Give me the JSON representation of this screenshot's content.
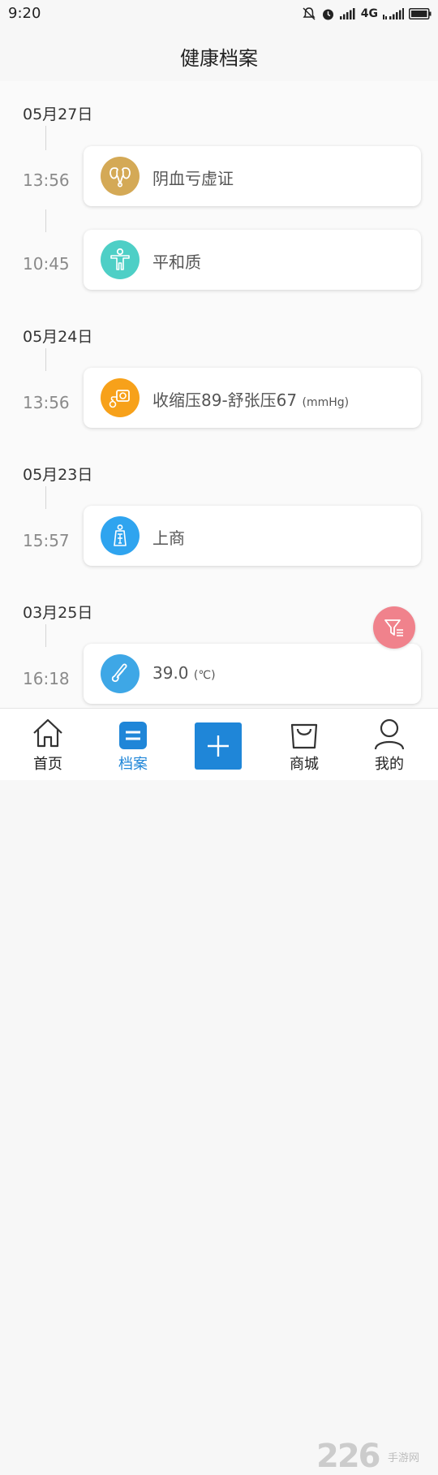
{
  "status_bar": {
    "time": "9:20",
    "network": "4G"
  },
  "header": {
    "title": "健康档案"
  },
  "timeline": [
    {
      "date": "05月27日",
      "entries": [
        {
          "time": "13:56",
          "text": "阴血亏虚证",
          "unit": "",
          "icon": "kidney-icon",
          "color": "#d4a956"
        },
        {
          "time": "10:45",
          "text": "平和质",
          "unit": "",
          "icon": "body-figure-icon",
          "color": "#4ecfc6"
        }
      ]
    },
    {
      "date": "05月24日",
      "entries": [
        {
          "time": "13:56",
          "text": "收缩压89-舒张压67",
          "unit": "(mmHg)",
          "icon": "blood-pressure-icon",
          "color": "#f7a11a"
        }
      ]
    },
    {
      "date": "05月23日",
      "entries": [
        {
          "time": "15:57",
          "text": "上商",
          "unit": "",
          "icon": "meridian-icon",
          "color": "#2fa4ef"
        }
      ]
    },
    {
      "date": "03月25日",
      "entries": [
        {
          "time": "16:18",
          "text": "39.0",
          "unit": "(℃)",
          "icon": "thermometer-icon",
          "color": "#3ea7e6"
        }
      ]
    }
  ],
  "tabbar": {
    "home_label": "首页",
    "records_label": "档案",
    "mall_label": "商城",
    "profile_label": "我的",
    "active_color": "#1f86d8"
  },
  "watermark": {
    "main": "226",
    "sub": "手游网"
  }
}
